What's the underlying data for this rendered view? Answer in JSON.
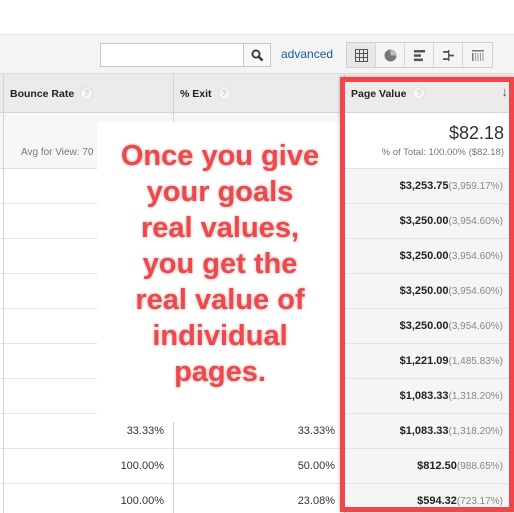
{
  "toolbar": {
    "search_value": "",
    "advanced_label": "advanced",
    "view_buttons": [
      {
        "icon": "table-grid-icon",
        "active": true
      },
      {
        "icon": "pie-chart-icon",
        "active": false
      },
      {
        "icon": "bar-performance-icon",
        "active": false
      },
      {
        "icon": "comparison-icon",
        "active": false
      },
      {
        "icon": "term-cloud-icon",
        "active": false
      }
    ]
  },
  "table": {
    "columns": [
      {
        "label": "Bounce Rate",
        "help": "?"
      },
      {
        "label": "% Exit",
        "help": "?"
      },
      {
        "label": "Page Value",
        "help": "?",
        "sort": "↓"
      }
    ],
    "summary": {
      "bounce_avg": "Avg for View: 70",
      "page_value_total": "$82.18",
      "page_value_sub": "% of Total: 100.00% ($82.18)"
    },
    "rows": [
      {
        "bounce": "",
        "exit": "",
        "value": "$3,253.75",
        "pct": "(3,959.17%)"
      },
      {
        "bounce": "",
        "exit": "",
        "value": "$3,250.00",
        "pct": "(3,954.60%)"
      },
      {
        "bounce": "",
        "exit": "",
        "value": "$3,250.00",
        "pct": "(3,954.60%)"
      },
      {
        "bounce": "",
        "exit": "",
        "value": "$3,250.00",
        "pct": "(3,954.60%)"
      },
      {
        "bounce": "",
        "exit": "",
        "value": "$3,250.00",
        "pct": "(3,954.60%)"
      },
      {
        "bounce": "",
        "exit": "",
        "value": "$1,221.09",
        "pct": "(1,485.83%)"
      },
      {
        "bounce": "",
        "exit": "",
        "value": "$1,083.33",
        "pct": "(1,318.20%)"
      },
      {
        "bounce": "33.33%",
        "exit": "33.33%",
        "value": "$1,083.33",
        "pct": "(1,318.20%)"
      },
      {
        "bounce": "100.00%",
        "exit": "50.00%",
        "value": "$812.50",
        "pct": "(988.65%)"
      },
      {
        "bounce": "100.00%",
        "exit": "23.08%",
        "value": "$594.32",
        "pct": "(723.17%)"
      }
    ]
  },
  "annotation": {
    "lines": [
      "Once you give",
      "your goals",
      "real values,",
      "you get the",
      "real value of",
      "individual",
      "pages."
    ],
    "color": "#f2474a"
  }
}
